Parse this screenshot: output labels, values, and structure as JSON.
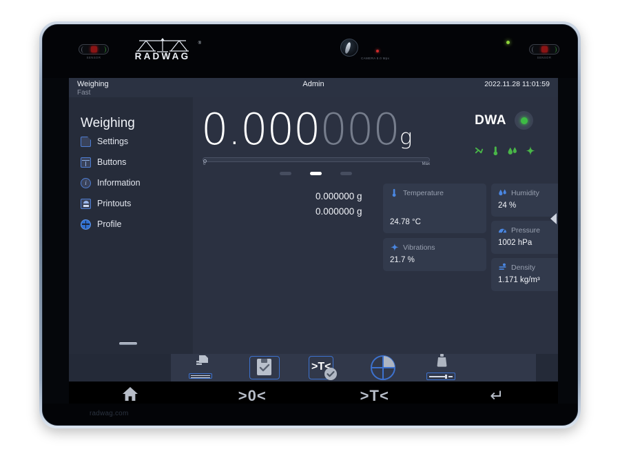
{
  "device": {
    "brand": "RADWAG",
    "registered_mark": "®",
    "sensor_left_label": "SENSOR",
    "sensor_right_label": "SENSOR",
    "camera_label": "CAMERA 8.0 Mpx",
    "footer_url": "radwag.com"
  },
  "status_bar": {
    "title": "Weighing",
    "subtitle": "Fast",
    "user": "Admin",
    "datetime": "2022.11.28 11:01:59"
  },
  "sidebar": {
    "title": "Weighing",
    "items": [
      {
        "label": "Settings",
        "icon": "document-icon"
      },
      {
        "label": "Buttons",
        "icon": "window-icon"
      },
      {
        "label": "Information",
        "icon": "info-icon"
      },
      {
        "label": "Printouts",
        "icon": "printer-icon"
      },
      {
        "label": "Profile",
        "icon": "profile-icon"
      }
    ]
  },
  "weight": {
    "bright_part": "0.000",
    "dim_part": "000",
    "unit": "g",
    "bar_min": "0",
    "bar_max": "Max",
    "mode_label": "DWA",
    "mode_led_color": "#3dbb44"
  },
  "env_icons": [
    {
      "name": "airflow-icon",
      "glyph": "⇜",
      "color": "#49b648"
    },
    {
      "name": "temperature-icon",
      "glyph": "🌡",
      "color": "#49b648"
    },
    {
      "name": "humidity-icon",
      "glyph": "💧",
      "color": "#49b648"
    },
    {
      "name": "vibration-icon",
      "glyph": "✦",
      "color": "#49b648"
    }
  ],
  "page_dots": {
    "count": 3,
    "active_index": 1
  },
  "secondary_values": [
    "0.000000 g",
    "0.000000 g"
  ],
  "sensor_cards": [
    {
      "name": "temperature",
      "title": "Temperature",
      "value": "24.78 °C",
      "icon": "thermometer-icon"
    },
    {
      "name": "humidity",
      "title": "Humidity",
      "value": "24 %",
      "icon": "droplets-icon"
    },
    {
      "name": "pressure",
      "title": "Pressure",
      "value": "1002 hPa",
      "icon": "gauge-icon"
    },
    {
      "name": "vibrations",
      "title": "Vibrations",
      "value": "21.7 %",
      "icon": "sparkle-icon"
    },
    {
      "name": "density",
      "title": "Density",
      "value": "1.171 kg/m³",
      "icon": "density-icon"
    }
  ],
  "toolbar": [
    {
      "name": "printout-button",
      "icon": "printer-with-bar-icon"
    },
    {
      "name": "save-button",
      "icon": "save-disk-icon"
    },
    {
      "name": "tare-confirm-button",
      "icon": "tare-check-icon"
    },
    {
      "name": "adjustment-button",
      "icon": "pie-quarters-icon"
    },
    {
      "name": "calibration-button",
      "icon": "weight-slider-icon"
    }
  ],
  "navbar": [
    {
      "name": "home-button",
      "glyph": "⌂"
    },
    {
      "name": "zero-button",
      "glyph": ">0<"
    },
    {
      "name": "tare-button",
      "glyph": ">T<"
    },
    {
      "name": "enter-button",
      "glyph": "↵"
    }
  ],
  "colors": {
    "screen_bg": "#2b3141",
    "sidebar_bg": "#262c3a",
    "card_bg": "#323a4c",
    "accent_blue": "#3d72cf",
    "accent_green": "#49b648",
    "text_primary": "#f2f4f9",
    "text_muted": "#98a0b0"
  }
}
